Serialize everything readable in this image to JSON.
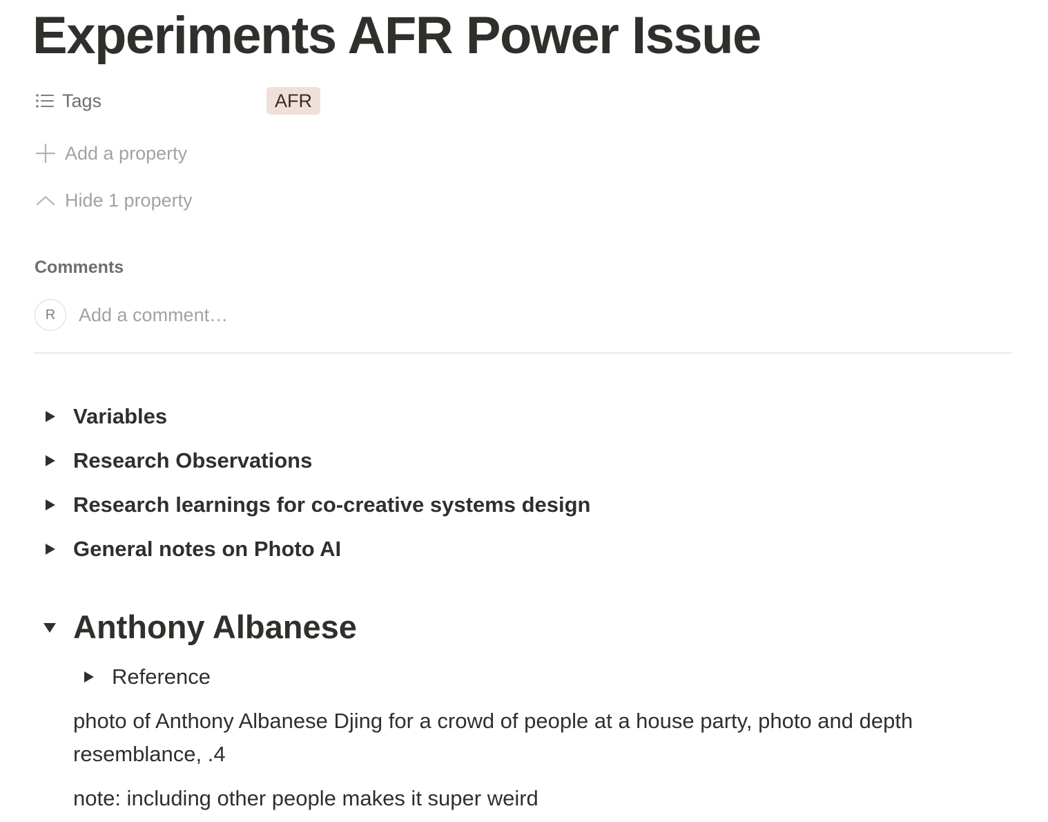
{
  "page": {
    "title": "Experiments AFR Power Issue"
  },
  "properties": {
    "tags_label": "Tags",
    "tags": [
      "AFR"
    ],
    "add_property_label": "Add a property",
    "hide_property_label": "Hide 1 property"
  },
  "comments": {
    "label": "Comments",
    "avatar_initial": "R",
    "placeholder": "Add a comment…"
  },
  "toggles": [
    {
      "label": "Variables",
      "expanded": false
    },
    {
      "label": "Research Observations",
      "expanded": false
    },
    {
      "label": "Research learnings for co-creative systems design",
      "expanded": false
    },
    {
      "label": "General notes on Photo AI",
      "expanded": false
    }
  ],
  "section": {
    "heading": "Anthony Albanese",
    "expanded": true,
    "reference_toggle": "Reference",
    "paragraphs": [
      "photo of Anthony Albanese Djing for a crowd of people at a house party, photo and depth resemblance, .4",
      "note: including other people makes it super weird"
    ]
  },
  "colors": {
    "text": "#2f2f2c",
    "muted": "#a3a29e",
    "tag_bg": "#efe0d9",
    "divider": "#ebeae7"
  }
}
